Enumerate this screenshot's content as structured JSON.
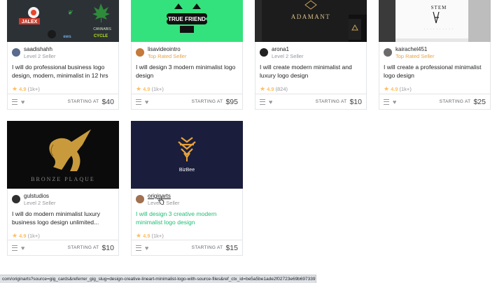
{
  "gigs": [
    {
      "seller": "saadishahh",
      "level": "Level 2 Seller",
      "title": "I will do professional business logo design, modern, minimalist in 12 hrs",
      "rating": "4.9",
      "reviews": "(1k+)",
      "starting": "STARTING AT",
      "price": "$40",
      "thumb_text": [
        "JALEX",
        "CANNABIS",
        "CYCLE"
      ]
    },
    {
      "seller": "lisavideointro",
      "level": "Top Rated Seller",
      "title": "I will design 3 modern minimalist logo design",
      "rating": "4.9",
      "reviews": "(1k+)",
      "starting": "STARTING AT",
      "price": "$95",
      "thumb_text": "TRUE FRIEND"
    },
    {
      "seller": "arona1",
      "level": "Level 2 Seller",
      "title": "I will create modern minimalist and luxury logo design",
      "rating": "4.9",
      "reviews": "(824)",
      "starting": "STARTING AT",
      "price": "$10",
      "thumb_text": "ADAMANT"
    },
    {
      "seller": "kairachel451",
      "level": "Top Rated Seller",
      "title": "I will create a professional minimalist logo design",
      "rating": "4.9",
      "reviews": "(1k+)",
      "starting": "STARTING AT",
      "price": "$25",
      "thumb_text": "STEM"
    },
    {
      "seller": "gulstudios",
      "level": "Level 2 Seller",
      "title": "I will do modern minimalist luxury business logo design unlimited...",
      "rating": "4.9",
      "reviews": "(1k+)",
      "starting": "STARTING AT",
      "price": "$10",
      "thumb_text": "BRONZE PLAQUE"
    },
    {
      "seller": "originarts",
      "level": "Level 2 Seller",
      "title": "I will design 3 creative modern minimalist logo design",
      "rating": "4.9",
      "reviews": "(1k+)",
      "starting": "STARTING AT",
      "price": "$15",
      "thumb_text": "BizBee"
    }
  ],
  "status_url": "com/originarts?source=gig_cards&referrer_gig_slug=design-creative-lineart-minimalist-logo-with-source-files&ref_ctx_id=be5a5be1ade2f02723e69b6973397b98",
  "colors": {
    "accent": "#1dbf73",
    "top_rated": "#e5a44b",
    "star": "#ffbe5b"
  }
}
